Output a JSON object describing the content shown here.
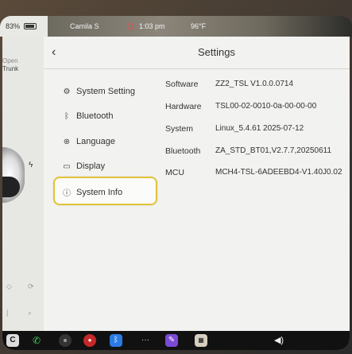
{
  "status_bar": {
    "battery": "83%",
    "user": "Camila S",
    "time": "1:03 pm",
    "temperature": "96°F"
  },
  "car_panel": {
    "open_label": "Open",
    "trunk_label": "Trunk"
  },
  "header": {
    "back_icon": "chevron-left-icon",
    "title": "Settings"
  },
  "menu": {
    "items": [
      {
        "label": "System Setting",
        "icon": "gear-icon"
      },
      {
        "label": "Bluetooth",
        "icon": "bluetooth-icon"
      },
      {
        "label": "Language",
        "icon": "globe-icon"
      },
      {
        "label": "Display",
        "icon": "display-icon"
      },
      {
        "label": "System Info",
        "icon": "info-icon",
        "active": true
      }
    ],
    "active_color": "#e2c33a"
  },
  "system_info": {
    "rows": [
      {
        "label": "Software",
        "value": "ZZ2_TSL V1.0.0.0714"
      },
      {
        "label": "Hardware",
        "value": "TSL00-02-0010-0a-00-00-00"
      },
      {
        "label": "System",
        "value": "Linux_5.4.61 2025-07-12"
      },
      {
        "label": "Bluetooth",
        "value": "ZA_STD_BT01,V2.7.7,20250611"
      },
      {
        "label": "MCU",
        "value": "MCH4-TSL-6ADEEBD4-V1.40J0.02"
      }
    ]
  },
  "dock": {
    "items": [
      "car-icon",
      "phone-icon",
      "camera-icon",
      "record-icon",
      "bluetooth-icon",
      "more-icon",
      "pen-icon",
      "app-icon",
      "volume-icon"
    ]
  }
}
